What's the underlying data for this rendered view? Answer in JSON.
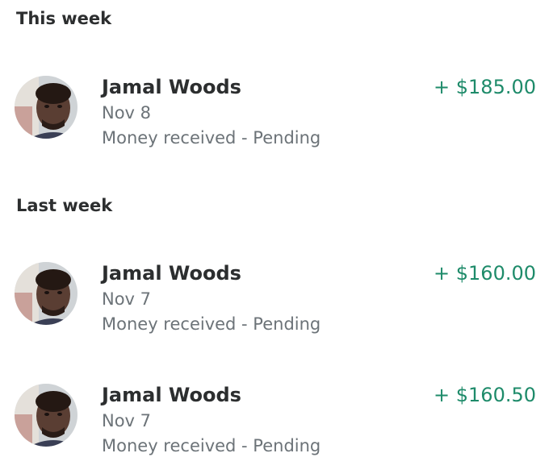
{
  "sections": [
    {
      "heading": "This week",
      "transactions": [
        {
          "name": "Jamal Woods",
          "date": "Nov 8",
          "status": "Money received - Pending",
          "amount": "+ $185.00",
          "avatar_icon": "user-photo-avatar"
        }
      ]
    },
    {
      "heading": "Last week",
      "transactions": [
        {
          "name": "Jamal Woods",
          "date": "Nov 7",
          "status": "Money received - Pending",
          "amount": "+ $160.00",
          "avatar_icon": "user-photo-avatar"
        },
        {
          "name": "Jamal Woods",
          "date": "Nov 7",
          "status": "Money received - Pending",
          "amount": "+ $160.50",
          "avatar_icon": "user-photo-avatar"
        }
      ]
    }
  ],
  "colors": {
    "amount_positive": "#1e8b6a",
    "secondary_text": "#6c7378",
    "primary_text": "#2c2e2f"
  }
}
